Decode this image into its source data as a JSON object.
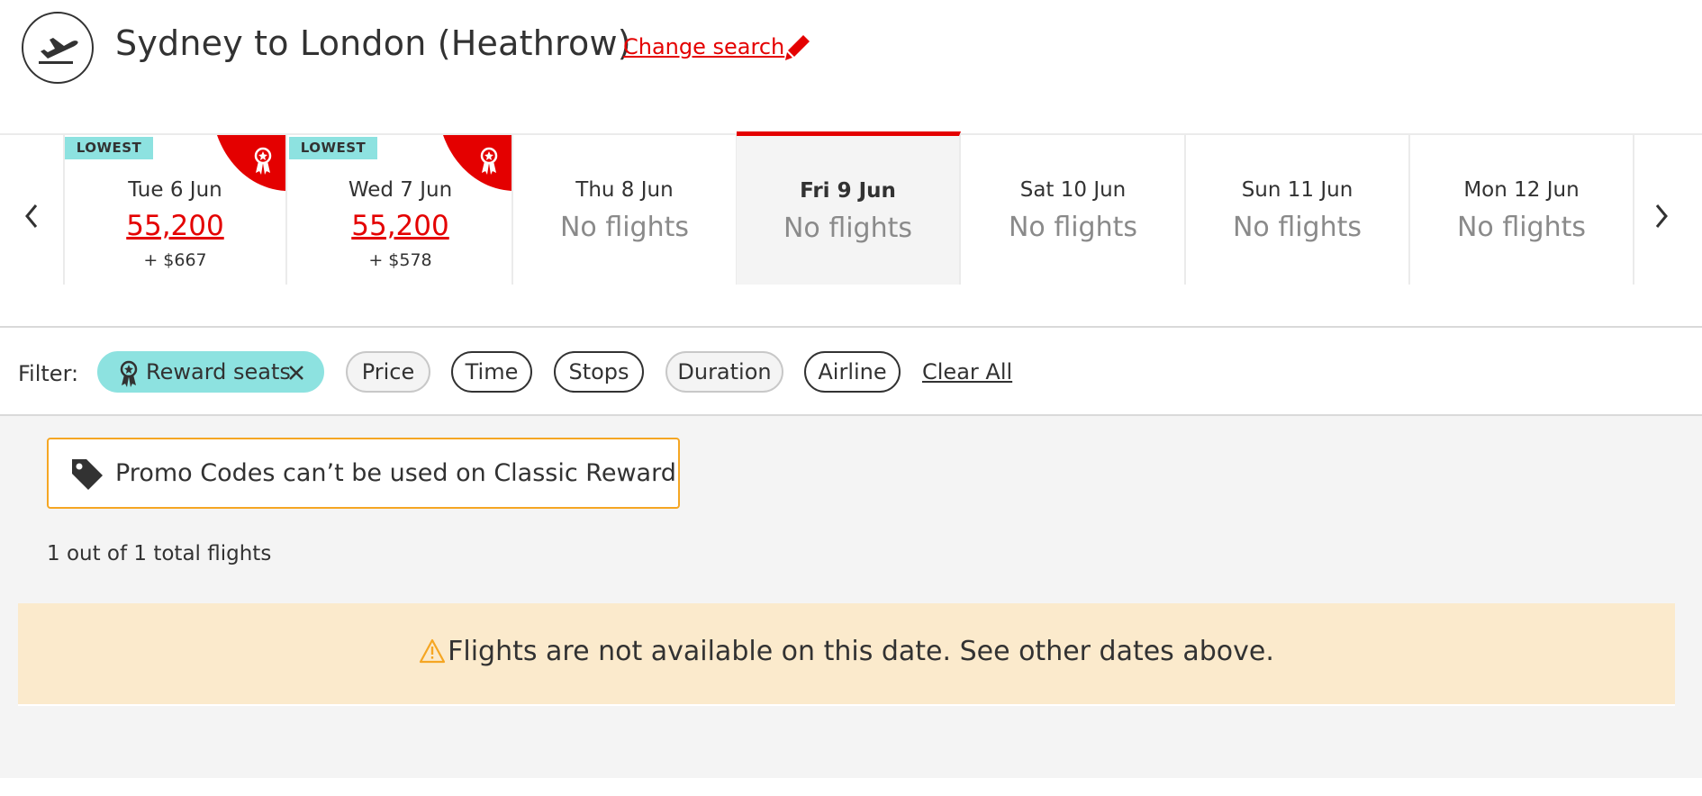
{
  "header": {
    "title": "Sydney to London (Heathrow)",
    "change_search": "Change search",
    "icons": {
      "departure": "plane-departure-icon",
      "edit": "pencil-icon"
    }
  },
  "colors": {
    "accent": "#e40000",
    "teal": "#8de2e0",
    "warning_border": "#f5a623",
    "warning_bg": "#fbeacc",
    "muted": "#8a8a8a"
  },
  "dates": [
    {
      "day": "Tue 6 Jun",
      "badge": "LOWEST",
      "points": "55,200",
      "tax": "+ $667",
      "reward": true
    },
    {
      "day": "Wed 7 Jun",
      "badge": "LOWEST",
      "points": "55,200",
      "tax": "+ $578",
      "reward": true
    },
    {
      "day": "Thu 8 Jun",
      "status": "No flights"
    },
    {
      "day": "Fri 9 Jun",
      "status": "No flights",
      "selected": true
    },
    {
      "day": "Sat 10 Jun",
      "status": "No flights"
    },
    {
      "day": "Sun 11 Jun",
      "status": "No flights"
    },
    {
      "day": "Mon 12 Jun",
      "status": "No flights"
    }
  ],
  "filter": {
    "label": "Filter:",
    "chips": [
      {
        "label": "Reward seats",
        "active": true
      },
      {
        "label": "Price"
      },
      {
        "label": "Time"
      },
      {
        "label": "Stops"
      },
      {
        "label": "Duration"
      },
      {
        "label": "Airline"
      }
    ],
    "clear_all": "Clear All"
  },
  "promo": {
    "text": "Promo Codes can’t be used on Classic Reward"
  },
  "results": {
    "count_text": "1 out of 1 total flights"
  },
  "alert": {
    "text": "Flights are not available on this date. See other dates above."
  }
}
